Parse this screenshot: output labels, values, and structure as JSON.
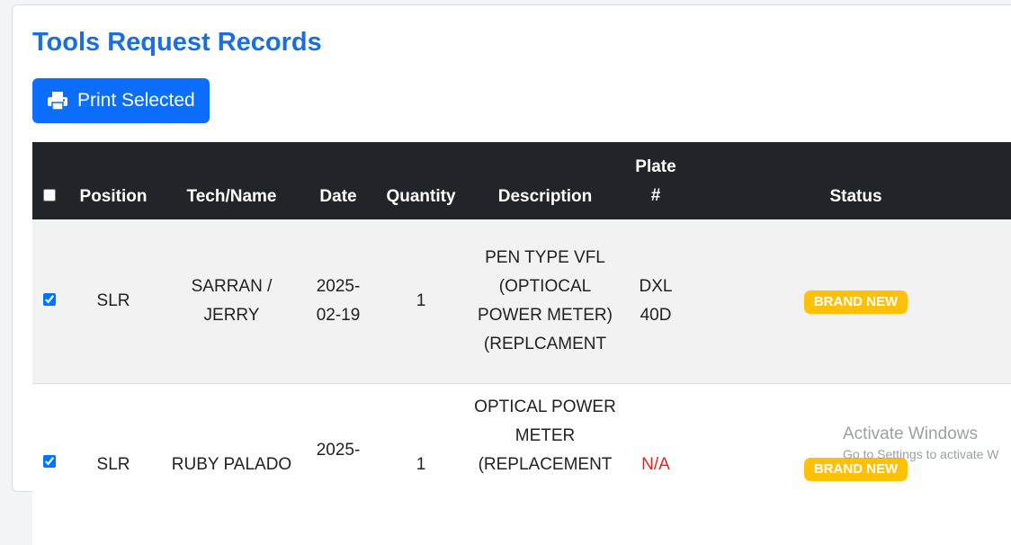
{
  "page": {
    "title": "Tools Request Records",
    "print_button_label": "Print Selected",
    "accent_color": "#0d6efd"
  },
  "table": {
    "headers": {
      "position": "Position",
      "tech_name": "Tech/Name",
      "date": "Date",
      "quantity": "Quantity",
      "description": "Description",
      "plate_line1": "Plate",
      "plate_line2": "#",
      "status": "Status"
    },
    "rows": [
      {
        "checked": true,
        "position": "SLR",
        "tech_name": "SARRAN / JERRY",
        "date": "2025-02-19",
        "quantity": "1",
        "description": "PEN TYPE VFL (OPTIOCAL POWER METER) (REPLCAMENT",
        "plate": "DXL 40D",
        "status": "BRAND NEW"
      },
      {
        "checked": true,
        "position": "SLR",
        "tech_name": "RUBY PALADO",
        "date": "2025-",
        "quantity": "1",
        "description": "OPTICAL POWER METER (REPLACEMENT",
        "plate": "N/A",
        "status": "BRAND NEW"
      }
    ]
  },
  "watermark": {
    "title": "Activate Windows",
    "subtitle": "Go to Settings to activate W"
  }
}
